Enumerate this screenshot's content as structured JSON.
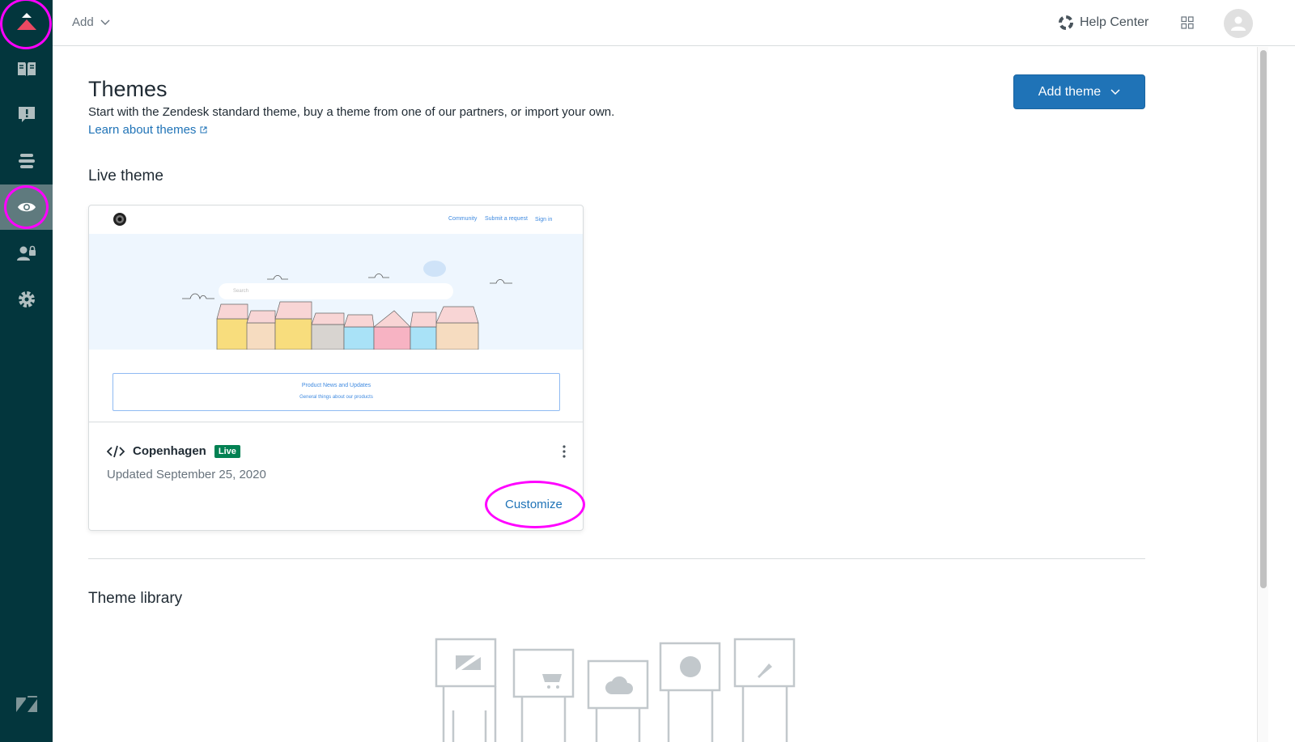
{
  "header": {
    "add_label": "Add",
    "help_center": "Help Center"
  },
  "sidebar": {
    "items": [
      {
        "name": "logo",
        "icon": "product-tray-icon"
      },
      {
        "name": "guide",
        "icon": "book-icon"
      },
      {
        "name": "moderation",
        "icon": "alert-chat-icon"
      },
      {
        "name": "arrange-content",
        "icon": "align-icon"
      },
      {
        "name": "customize-design",
        "icon": "eye-icon",
        "active": true
      },
      {
        "name": "user-permissions",
        "icon": "user-lock-icon"
      },
      {
        "name": "settings",
        "icon": "gear-icon"
      }
    ],
    "footer_icon": "zendesk-icon"
  },
  "page": {
    "title": "Themes",
    "subtitle": "Start with the Zendesk standard theme, buy a theme from one of our partners, or import your own.",
    "learn_link": "Learn about themes",
    "add_theme": "Add theme",
    "live_heading": "Live theme",
    "library_heading": "Theme library"
  },
  "live_theme": {
    "name": "Copenhagen",
    "badge": "Live",
    "updated": "Updated September 25, 2020",
    "customize": "Customize",
    "preview": {
      "nav": [
        "Community",
        "Submit a request",
        "Sign in"
      ],
      "search_placeholder": "Search",
      "box_title": "Product News and Updates",
      "box_subtitle": "General things about our products"
    }
  },
  "colors": {
    "sidebar": "#03363d",
    "accent": "#1f73b7",
    "live": "#038153",
    "annotation": "#ff00ff"
  }
}
